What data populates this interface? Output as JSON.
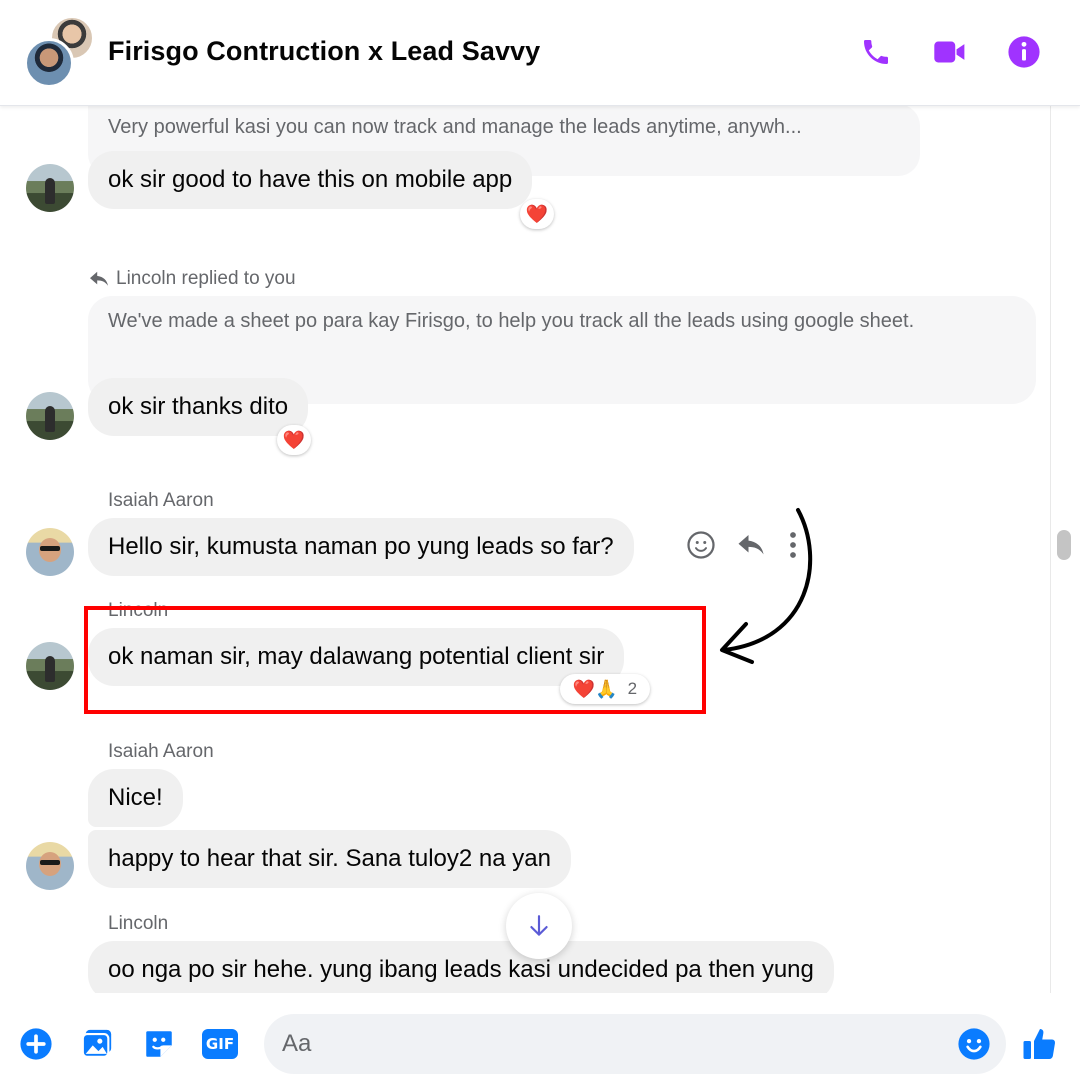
{
  "header": {
    "title": "Firisgo Contruction x Lead Savvy",
    "icons": [
      "phone-icon",
      "video-icon",
      "info-icon"
    ],
    "accent_color": "#a033ff"
  },
  "messages": {
    "m1": {
      "reply_preview": "Very powerful kasi you can now track and manage the leads anytime, anywh...",
      "text": "ok sir good to have this on mobile app",
      "reaction": "❤️"
    },
    "m2": {
      "replied_label": "Lincoln replied to you",
      "reply_preview": "We've made a sheet po para kay Firisgo, to help you track all the leads using google sheet.",
      "text": "ok sir thanks dito",
      "reaction": "❤️"
    },
    "m3": {
      "sender": "Isaiah Aaron",
      "text": "Hello sir, kumusta naman po yung leads so far?"
    },
    "m4": {
      "sender": "Lincoln",
      "text": "ok naman sir, may dalawang potential client sir",
      "reaction": "❤️🙏",
      "reaction_count": "2"
    },
    "m5": {
      "sender": "Isaiah Aaron",
      "text1": "Nice!",
      "text2": "happy to hear that sir. Sana tuloy2 na yan"
    },
    "m6": {
      "sender": "Lincoln",
      "text": "oo nga po sir hehe. yung ibang leads kasi undecided pa then yung"
    }
  },
  "annotation": {
    "highlight_color": "#ff0000",
    "arrow_color": "#000000"
  },
  "composer": {
    "placeholder": "Aa",
    "icons": [
      "plus-icon",
      "gallery-icon",
      "sticker-icon",
      "gif-icon",
      "emoji-icon",
      "like-icon"
    ],
    "gif_label": "GIF"
  },
  "scroll_down_icon": "arrow-down-icon"
}
